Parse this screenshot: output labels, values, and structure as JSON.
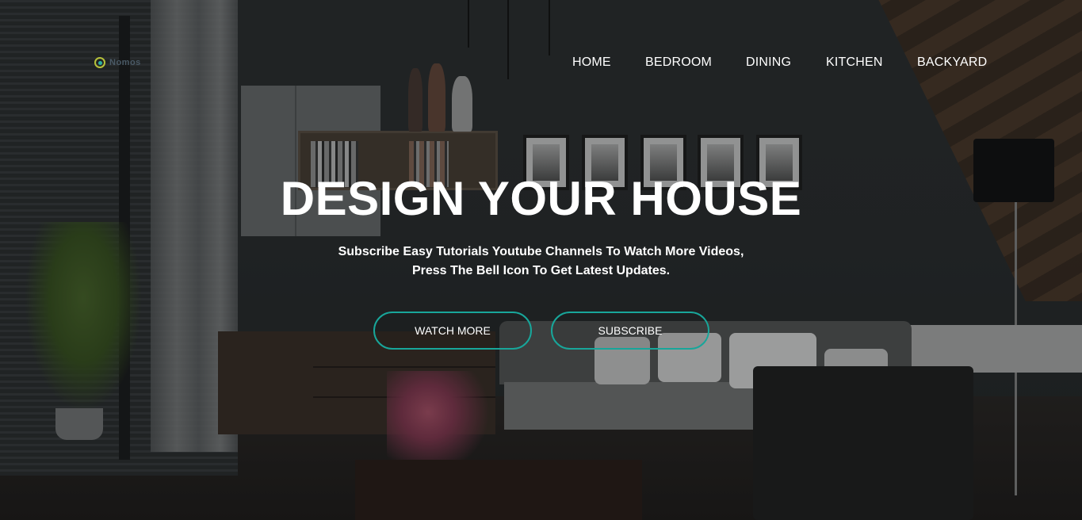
{
  "logo": {
    "text": "Nomos",
    "icon": "logo-mark-icon"
  },
  "nav": {
    "items": [
      {
        "label": "HOME"
      },
      {
        "label": "BEDROOM"
      },
      {
        "label": "DINING"
      },
      {
        "label": "KITCHEN"
      },
      {
        "label": "BACKYARD"
      }
    ]
  },
  "hero": {
    "title": "DESIGN YOUR HOUSE",
    "subtitle_line1": "Subscribe Easy Tutorials Youtube Channels To Watch More Videos,",
    "subtitle_line2": "Press The Bell Icon To Get Latest Updates.",
    "buttons": {
      "watch_more": "WATCH MORE",
      "subscribe": "SUBSCRIBE"
    }
  },
  "colors": {
    "accent": "#18a69a",
    "text": "#ffffff"
  }
}
